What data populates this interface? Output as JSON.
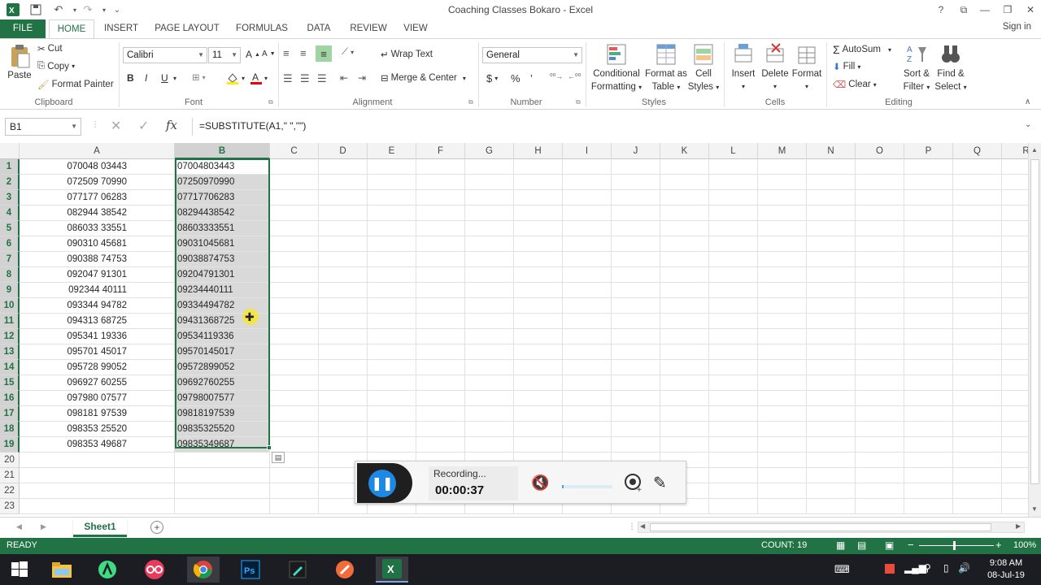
{
  "window": {
    "title": "Coaching Classes Bokaro - Excel",
    "help": "?",
    "signin": "Sign in"
  },
  "tabs": [
    "FILE",
    "HOME",
    "INSERT",
    "PAGE LAYOUT",
    "FORMULAS",
    "DATA",
    "REVIEW",
    "VIEW"
  ],
  "ribbon": {
    "clipboard": {
      "paste": "Paste",
      "cut": "Cut",
      "copy": "Copy",
      "format_painter": "Format Painter",
      "label": "Clipboard"
    },
    "font": {
      "name": "Calibri",
      "size": "11",
      "bold": "B",
      "italic": "I",
      "underline": "U",
      "grow": "A",
      "shrink": "A",
      "label": "Font"
    },
    "alignment": {
      "wrap": "Wrap Text",
      "merge": "Merge & Center",
      "label": "Alignment"
    },
    "number": {
      "format": "General",
      "currency": "$",
      "percent": "%",
      "comma": "’",
      "label": "Number"
    },
    "styles": {
      "conditional": [
        "Conditional",
        "Formatting"
      ],
      "table": [
        "Format as",
        "Table"
      ],
      "cell": [
        "Cell",
        "Styles"
      ],
      "label": "Styles"
    },
    "cells": {
      "insert": "Insert",
      "delete": "Delete",
      "format": "Format",
      "label": "Cells"
    },
    "editing": {
      "autosum": "AutoSum",
      "fill": "Fill",
      "clear": "Clear",
      "sort": [
        "Sort &",
        "Filter"
      ],
      "find": [
        "Find &",
        "Select"
      ],
      "label": "Editing"
    }
  },
  "formula_bar": {
    "name_box": "B1",
    "formula": "=SUBSTITUTE(A1,\" \",\"\")",
    "fx": "fx"
  },
  "columns": [
    "A",
    "B",
    "C",
    "D",
    "E",
    "F",
    "G",
    "H",
    "I",
    "J",
    "K",
    "L",
    "M",
    "N",
    "O",
    "P",
    "Q",
    "R"
  ],
  "rows": [
    "1",
    "2",
    "3",
    "4",
    "5",
    "6",
    "7",
    "8",
    "9",
    "10",
    "11",
    "12",
    "13",
    "14",
    "15",
    "16",
    "17",
    "18",
    "19",
    "20",
    "21",
    "22",
    "23"
  ],
  "col_a": [
    "070048 03443",
    "072509 70990",
    "077177 06283",
    "082944 38542",
    "086033 33551",
    "090310 45681",
    "090388 74753",
    "092047 91301",
    "092344 40111",
    "093344 94782",
    "094313 68725",
    "095341 19336",
    "095701 45017",
    "095728 99052",
    "096927 60255",
    "097980 07577",
    "098181 97539",
    "098353 25520",
    "098353 49687"
  ],
  "col_b": [
    "07004803443",
    "07250970990",
    "07717706283",
    "08294438542",
    "08603333551",
    "09031045681",
    "09038874753",
    "09204791301",
    "09234440111",
    "09334494782",
    "09431368725",
    "09534119336",
    "09570145017",
    "09572899052",
    "09692760255",
    "09798007577",
    "09818197539",
    "09835325520",
    "09835349687"
  ],
  "sheet": {
    "name": "Sheet1"
  },
  "status": {
    "ready": "READY",
    "count": "COUNT: 19",
    "zoom": "100%"
  },
  "recorder": {
    "status": "Recording...",
    "time": "00:00:37"
  },
  "taskbar": {
    "time": "9:08 AM",
    "date": "08-Jul-19"
  },
  "colors": {
    "excel_green": "#217346",
    "selection": "#d9d9d9",
    "taskbar": "#1c1d22"
  }
}
